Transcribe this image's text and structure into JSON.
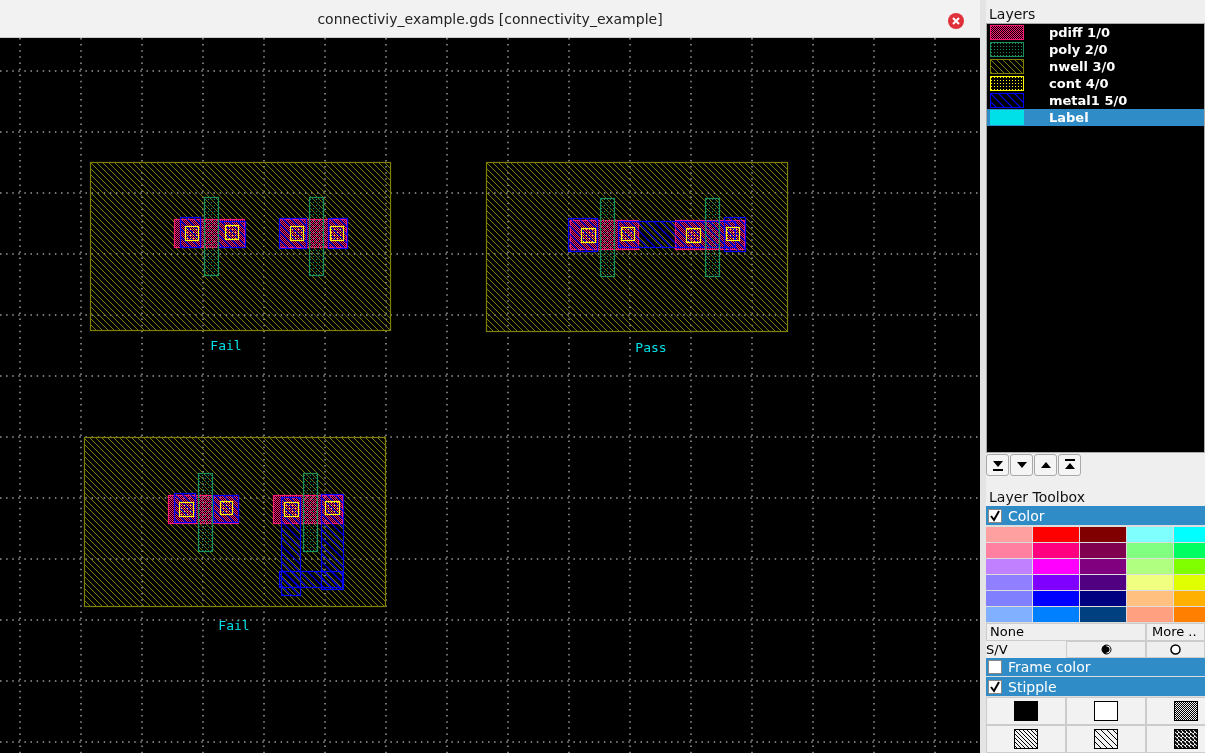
{
  "window": {
    "title": "connectiviy_example.gds [connectivity_example]"
  },
  "layout": {
    "labels": [
      "Fail",
      "Pass",
      "Fail"
    ]
  },
  "layers_panel": {
    "title": "Layers",
    "layers": [
      {
        "name": "pdiff 1/0",
        "color": "#ff1a75",
        "kind": "checker",
        "selected": false
      },
      {
        "name": "poly 2/0",
        "color": "#1a8f5a",
        "kind": "dots",
        "selected": false
      },
      {
        "name": "nwell 3/0",
        "color": "#808000",
        "kind": "hatch",
        "selected": false
      },
      {
        "name": "cont 4/0",
        "color": "#ffff00",
        "kind": "dots",
        "selected": false
      },
      {
        "name": "metal1 5/0",
        "color": "#0000ff",
        "kind": "wide_hatch",
        "selected": false
      },
      {
        "name": "Label",
        "color": "#00e0e8",
        "kind": "solid",
        "selected": true
      }
    ]
  },
  "toolbox": {
    "title": "Layer Toolbox",
    "color_section": {
      "label": "Color",
      "checked": true
    },
    "palette": [
      {
        "color": "#ffa0a0"
      },
      {
        "color": "#ff0000"
      },
      {
        "color": "#800000"
      },
      {
        "color": "#80ffff"
      },
      {
        "color": "#00ffff"
      },
      {
        "color": "#ff80a0"
      },
      {
        "color": "#ff0080"
      },
      {
        "color": "#800050"
      },
      {
        "color": "#80ff80"
      },
      {
        "color": "#00ff60"
      },
      {
        "color": "#c080ff"
      },
      {
        "color": "#ff00ff"
      },
      {
        "color": "#800080"
      },
      {
        "color": "#b0ff80"
      },
      {
        "color": "#80ff00"
      },
      {
        "color": "#9080ff"
      },
      {
        "color": "#8000ff"
      },
      {
        "color": "#500080"
      },
      {
        "color": "#f0ff80"
      },
      {
        "color": "#e0ff00"
      },
      {
        "color": "#8080ff"
      },
      {
        "color": "#0000ff"
      },
      {
        "color": "#000080"
      },
      {
        "color": "#ffc080"
      },
      {
        "color": "#ffb000"
      },
      {
        "color": "#80b0ff"
      },
      {
        "color": "#0080ff"
      },
      {
        "color": "#004080"
      },
      {
        "color": "#ffa080"
      },
      {
        "color": "#ff8000"
      }
    ],
    "none_button": "None",
    "more_button": "More ..",
    "sv_label": "S/V",
    "frame_section": {
      "label": "Frame color",
      "checked": false
    },
    "stipple_section": {
      "label": "Stipple",
      "checked": true
    }
  }
}
